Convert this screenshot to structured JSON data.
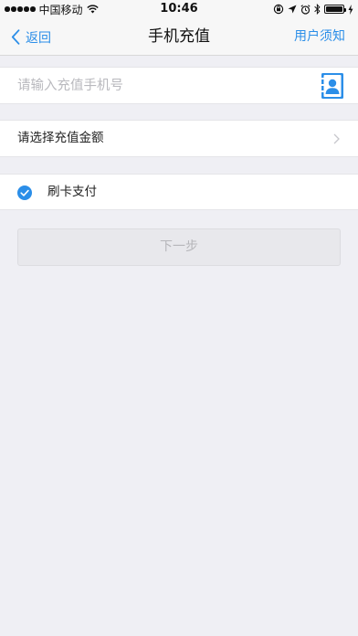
{
  "status_bar": {
    "carrier": "中国移动",
    "time": "10:46"
  },
  "nav": {
    "back_label": "返回",
    "title": "手机充值",
    "right_label": "用户须知"
  },
  "phone": {
    "placeholder": "请输入充值手机号",
    "value": ""
  },
  "amount": {
    "label": "请选择充值金额"
  },
  "payment": {
    "label": "刷卡支付",
    "checked": true
  },
  "next_button": {
    "label": "下一步",
    "enabled": false
  },
  "colors": {
    "accent": "#2b8ee8",
    "background": "#efeff4"
  }
}
